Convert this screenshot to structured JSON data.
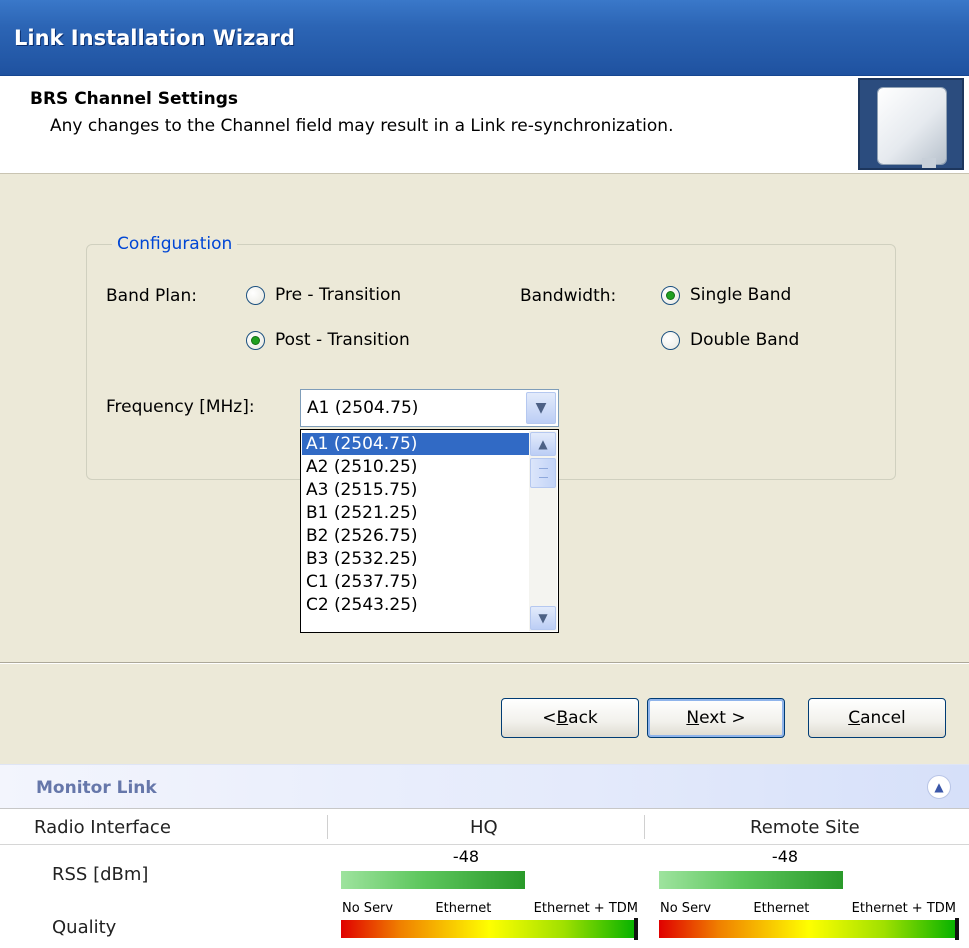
{
  "window": {
    "title": "Link Installation Wizard"
  },
  "header": {
    "title": "BRS Channel Settings",
    "description": "Any changes to the Channel field may result in a Link re-synchronization."
  },
  "configuration": {
    "legend": "Configuration",
    "band_plan": {
      "label": "Band Plan:",
      "options": [
        {
          "label": "Pre - Transition",
          "checked": false
        },
        {
          "label": "Post - Transition",
          "checked": true
        }
      ]
    },
    "bandwidth": {
      "label": "Bandwidth:",
      "options": [
        {
          "label": "Single Band",
          "checked": true
        },
        {
          "label": "Double Band",
          "checked": false
        }
      ]
    },
    "frequency": {
      "label": "Frequency [MHz]:",
      "value": "A1 (2504.75)",
      "options": [
        "A1 (2504.75)",
        "A2 (2510.25)",
        "A3 (2515.75)",
        "B1 (2521.25)",
        "B2 (2526.75)",
        "B3 (2532.25)",
        "C1 (2537.75)",
        "C2 (2543.25)"
      ],
      "selected_index": 0
    }
  },
  "buttons": {
    "back": {
      "pre": "< ",
      "mnemonic": "B",
      "post": "ack"
    },
    "next": {
      "pre": "",
      "mnemonic": "N",
      "post": "ext >"
    },
    "cancel": {
      "pre": "",
      "mnemonic": "C",
      "post": "ancel"
    }
  },
  "monitor": {
    "title": "Monitor Link",
    "columns": [
      "Radio Interface",
      "HQ",
      "Remote Site"
    ],
    "rss_label": "RSS [dBm]",
    "quality_label": "Quality",
    "hq": {
      "rss": "-48",
      "rss_fill": 0.62
    },
    "remote": {
      "rss": "-48",
      "rss_fill": 0.62
    },
    "quality_scale": [
      "No Serv",
      "Ethernet",
      "Ethernet + TDM"
    ],
    "quality_level": 1.0,
    "colors": {
      "rss_bar": "#2a9a2a",
      "accent": "#316ac5",
      "legend_text": "#0046d5"
    }
  }
}
